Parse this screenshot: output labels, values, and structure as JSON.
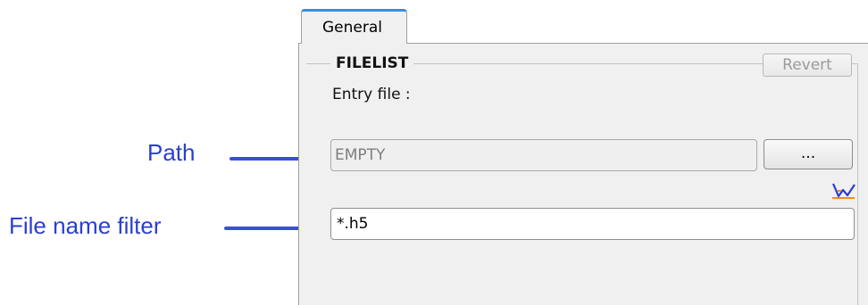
{
  "tabs": [
    {
      "label": "General",
      "active": true
    }
  ],
  "group": {
    "title": "FILELIST",
    "revert_label": "Revert"
  },
  "entry_label": "Entry file :",
  "path_field": {
    "value": "EMPTY"
  },
  "browse_label": "...",
  "filter_field": {
    "value": "*.h5"
  },
  "callouts": {
    "path": "Path",
    "filter": "File name filter"
  },
  "icons": {
    "chart": "line-chart-icon"
  },
  "colors": {
    "accent_tab": "#3a8fd8",
    "callout": "#2a3fd0",
    "chart_icon_line": "#2b3fc8",
    "chart_icon_accent": "#f08a1c"
  }
}
